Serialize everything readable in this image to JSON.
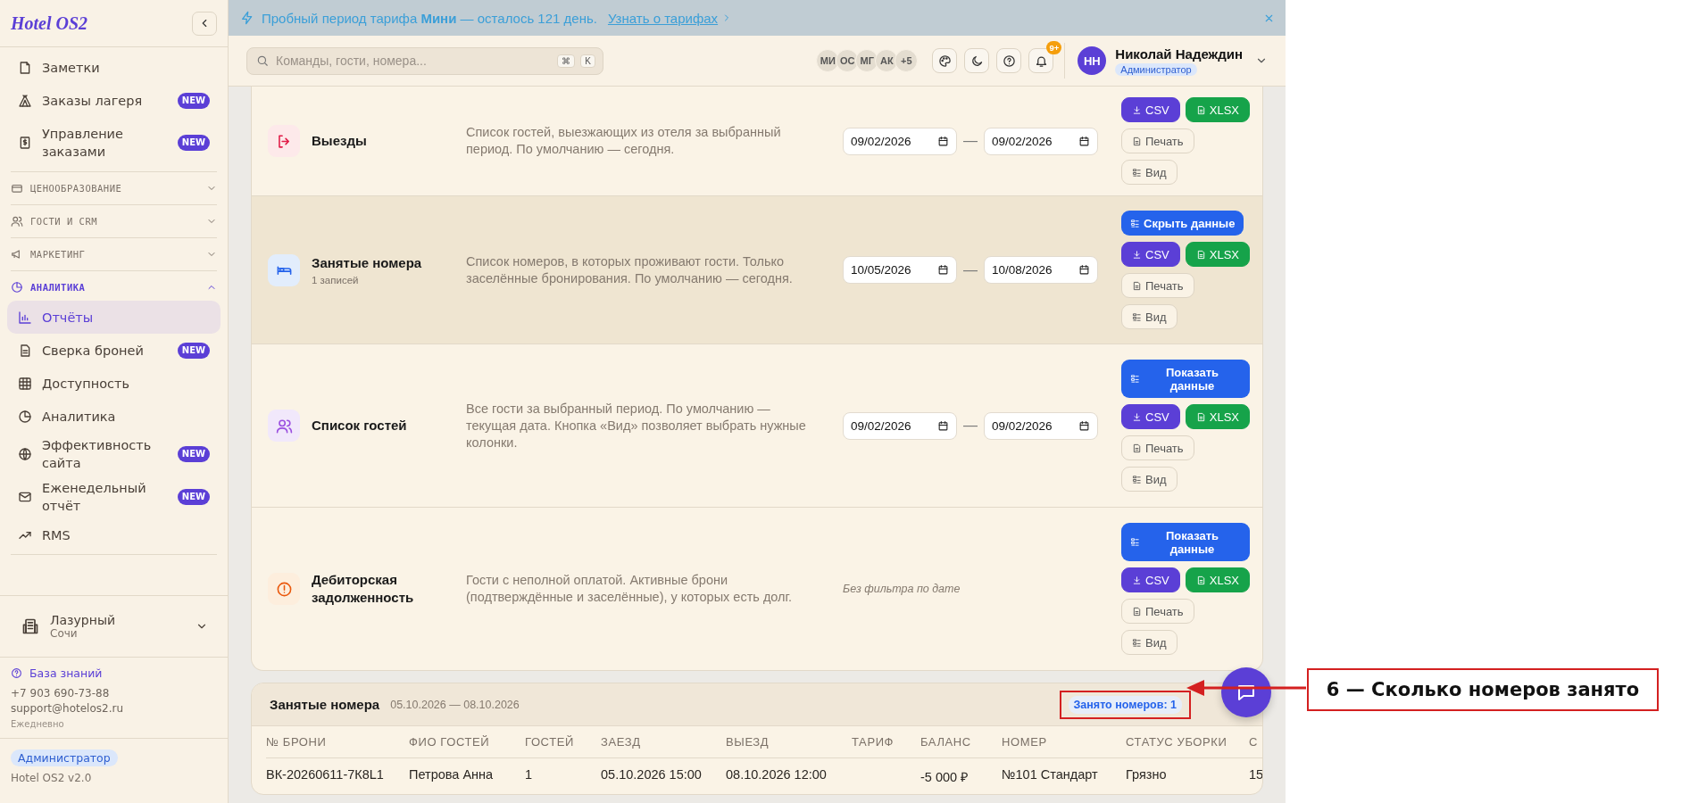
{
  "banner": {
    "text": "Пробный период тарифа **Мини** — осталось 121 день.",
    "link": "Узнать о тарифах"
  },
  "sidebar": {
    "logo": "Hotel OS2",
    "nav": [
      {
        "kind": "link",
        "label": "Заметки",
        "selected": false
      },
      {
        "kind": "link",
        "label": "Заказы лагеря",
        "badge": "NEW",
        "selected": false
      },
      {
        "kind": "link",
        "label": "Управление заказами",
        "badge": "NEW",
        "selected": false
      },
      {
        "kind": "section",
        "label": "ЦЕНООБРАЗОВАНИЕ",
        "expanded": false
      },
      {
        "kind": "section",
        "label": "ГОСТИ И CRM",
        "expanded": false
      },
      {
        "kind": "section",
        "label": "МАРКЕТИНГ",
        "expanded": false
      },
      {
        "kind": "section",
        "label": "АНАЛИТИКА",
        "expanded": true,
        "children": [
          {
            "kind": "link",
            "label": "Отчёты",
            "selected": true
          },
          {
            "kind": "link",
            "label": "Сверка броней",
            "badge": "NEW",
            "selected": false
          },
          {
            "kind": "link",
            "label": "Доступность",
            "selected": false
          },
          {
            "kind": "link",
            "label": "Аналитика",
            "selected": false
          },
          {
            "kind": "link",
            "label": "Эффективность сайта",
            "badge": "NEW",
            "selected": false
          },
          {
            "kind": "link",
            "label": "Еженедельный отчёт",
            "badge": "NEW",
            "selected": false
          },
          {
            "kind": "link",
            "label": "RMS",
            "selected": false
          }
        ]
      }
    ],
    "hotel": {
      "name": "Лазурный",
      "city": "Сочи"
    },
    "support": {
      "link": "База знаний",
      "phone": "+7 903 690-73-88",
      "email": "support@hotelos2.ru",
      "hours": "Ежедневно"
    },
    "role": "Администратор",
    "version": "Hotel OS2 v2.0"
  },
  "header": {
    "search": {
      "placeholder": "Команды, гости, номера...",
      "keys": [
        "⌘",
        "K"
      ]
    },
    "presence": [
      "МИ",
      "ОС",
      "МГ",
      "АК",
      "+5"
    ],
    "notifications": "9+",
    "user": {
      "initials": "НН",
      "name": "Николай Надеждин",
      "role": "Администратор"
    }
  },
  "reports": [
    {
      "title": "Выезды",
      "description": "Список гостей, выезжающих из отеля за выбранный период. По умолчанию — сегодня.",
      "date_from": "09/02/2026",
      "separator": "—",
      "date_to": "09/02/2026",
      "buttons": [
        "CSV",
        "XLSX",
        "Печать",
        "Вид"
      ],
      "selected": false
    },
    {
      "title": "Занятые номера",
      "subtitle": "1 записей",
      "description": "Список номеров, в которых проживают гости. Только заселённые бронирования. По умолчанию — сегодня.",
      "date_from": "10/05/2026",
      "separator": "—",
      "date_to": "10/08/2026",
      "toggle": "Скрыть данные",
      "buttons": [
        "CSV",
        "XLSX",
        "Печать",
        "Вид"
      ],
      "selected": true
    },
    {
      "title": "Список гостей",
      "description": "Все гости за выбранный период. По умолчанию — текущая дата. Кнопка «Вид» позволяет выбрать нужные колонки.",
      "date_from": "09/02/2026",
      "separator": "—",
      "date_to": "09/02/2026",
      "toggle": "Показать данные",
      "buttons": [
        "CSV",
        "XLSX",
        "Печать",
        "Вид"
      ],
      "selected": false
    },
    {
      "title": "Дебиторская задолженность",
      "description": "Гости с неполной оплатой. Активные брони (подтверждённые и заселённые), у которых есть долг.",
      "no_filter": "Без фильтра по дате",
      "toggle": "Показать данные",
      "buttons": [
        "CSV",
        "XLSX",
        "Печать",
        "Вид"
      ],
      "selected": false
    }
  ],
  "table": {
    "title": "Занятые номера",
    "range": "05.10.2026 — 08.10.2026",
    "count": "Занято номеров: 1",
    "columns": [
      "№ БРОНИ",
      "ФИО ГОСТЕЙ",
      "ГОСТЕЙ",
      "ЗАЕЗД",
      "ВЫЕЗД",
      "ТАРИФ",
      "БАЛАНС",
      "НОМЕР",
      "СТАТУС УБОРКИ",
      "С"
    ],
    "rows": [
      [
        "ВК-20260611-7К8L1",
        "Петрова Анна",
        "1",
        "05.10.2026 15:00",
        "08.10.2026 12:00",
        "",
        "-5 000 ₽",
        "№101 Стандарт",
        "Грязно",
        "15"
      ]
    ]
  },
  "callout": {
    "text": "6 — Сколько номеров занято"
  }
}
